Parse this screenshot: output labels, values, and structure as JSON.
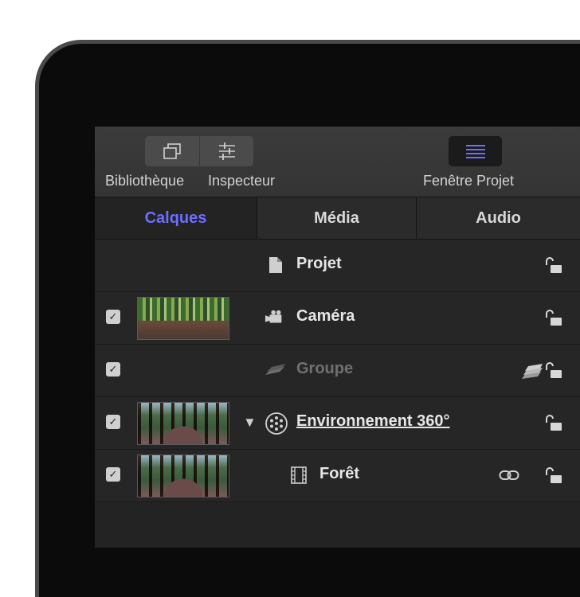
{
  "toolbar": {
    "library_label": "Bibliothèque",
    "inspector_label": "Inspecteur",
    "project_label": "Fenêtre Projet",
    "project_accent": "#6d6dff"
  },
  "tabs": [
    {
      "label": "Calques",
      "active": true
    },
    {
      "label": "Média",
      "active": false
    },
    {
      "label": "Audio",
      "active": false
    }
  ],
  "layers": [
    {
      "name": "Projet",
      "checked": null,
      "icon": "document-icon",
      "thumb": null
    },
    {
      "name": "Caméra",
      "checked": true,
      "icon": "camera-icon",
      "thumb": "forest-path"
    },
    {
      "name": "Groupe",
      "checked": true,
      "icon": "group-layers-icon",
      "thumb": null,
      "dimmed": true
    },
    {
      "name": "Environnement 360°",
      "checked": true,
      "icon": "360-environment-icon",
      "thumb": "panorama",
      "expanded": true
    },
    {
      "name": "Forêt",
      "checked": true,
      "icon": "film-icon",
      "thumb": "panorama"
    }
  ],
  "check_mark": "✓",
  "disclosure": "▼"
}
